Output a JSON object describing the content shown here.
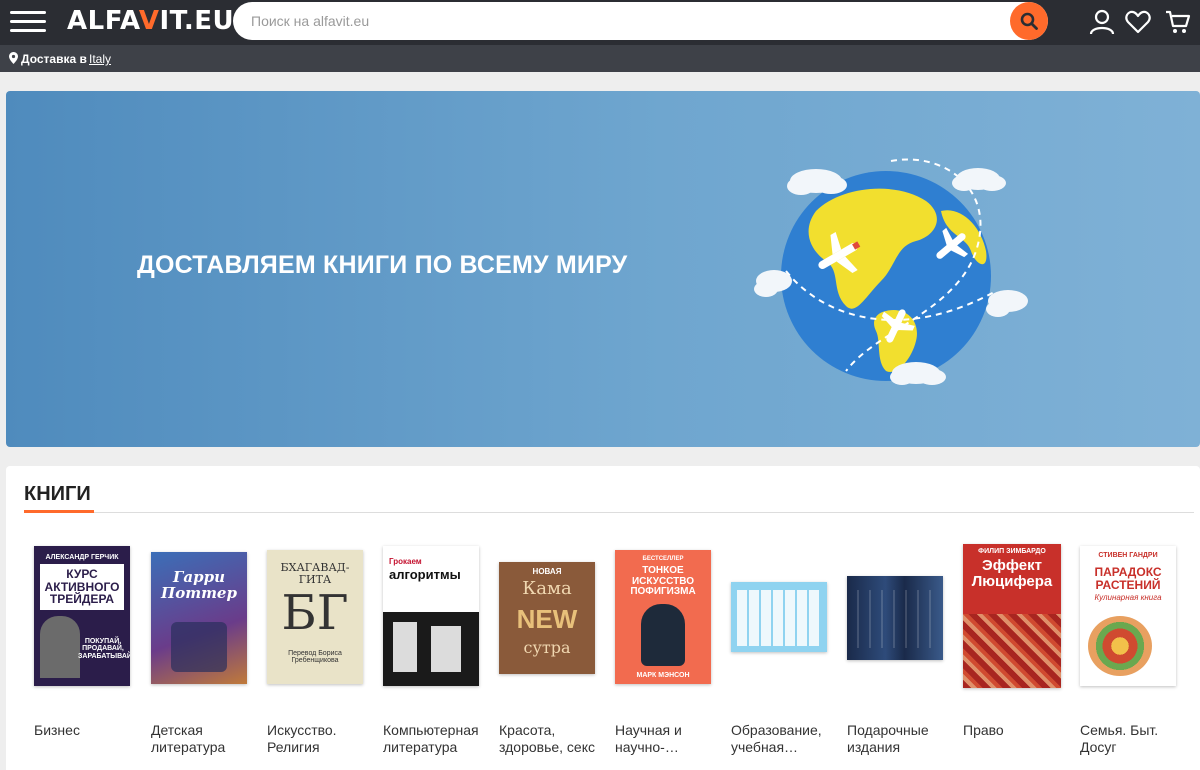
{
  "header": {
    "logo_prefix": "ALFA",
    "logo_accent": "V",
    "logo_suffix": "IT.EU",
    "search_placeholder": "Поиск на alfavit.eu"
  },
  "delivery": {
    "label": "Доставка в",
    "country": "Italy"
  },
  "banner": {
    "text": "ДОСТАВЛЯЕМ КНИГИ ПО ВСЕМУ МИРУ"
  },
  "books": {
    "title": "КНИГИ",
    "categories": [
      {
        "label": "Бизнес",
        "cover": {
          "top": "АЛЕКСАНДР ГЕРЧИК",
          "main": "КУРС АКТИВНОГО ТРЕЙДЕРА",
          "sub": "ПОКУПАЙ, ПРОДАВАЙ, ЗАРАБАТЫВАЙ"
        }
      },
      {
        "label": "Детская литература",
        "cover": {
          "main": "Гарри Поттер"
        }
      },
      {
        "label": "Искусство. Религия",
        "cover": {
          "main": "БХАГАВАД-ГИТА",
          "big": "БГ",
          "sub": "Перевод Бориса Гребенщикова"
        }
      },
      {
        "label": "Компьютерная литература",
        "cover": {
          "top": "Грокаем",
          "main": "алгоритмы"
        }
      },
      {
        "label": "Красота, здоровье, секс",
        "cover": {
          "top": "НОВАЯ",
          "main": "Кама",
          "big": "NEW",
          "sub": "сутра"
        }
      },
      {
        "label": "Научная и научно-…",
        "cover": {
          "top": "БЕСТСЕЛЛЕР",
          "main": "ТОНКОЕ ИСКУССТВО ПОФИГИЗМА",
          "sub": "МАРК МЭНСОН"
        }
      },
      {
        "label": "Образование, учебная…",
        "cover": {}
      },
      {
        "label": "Подарочные издания",
        "cover": {}
      },
      {
        "label": "Право",
        "cover": {
          "top": "ФИЛИП ЗИМБАРДО",
          "main": "Эффект Люцифера"
        }
      },
      {
        "label": "Семья. Быт. Досуг",
        "cover": {
          "top": "СТИВЕН ГАНДРИ",
          "main": "ПАРАДОКС РАСТЕНИЙ",
          "sub": "Кулинарная книга"
        }
      }
    ]
  },
  "colors": {
    "accent": "#ff6a2b",
    "topbar": "#2b2d33",
    "delivery_bar": "#3e4148",
    "banner_blue": "#5a95c4"
  },
  "icons": [
    "menu-icon",
    "search-icon",
    "user-icon",
    "heart-icon",
    "cart-icon",
    "location-pin-icon"
  ]
}
